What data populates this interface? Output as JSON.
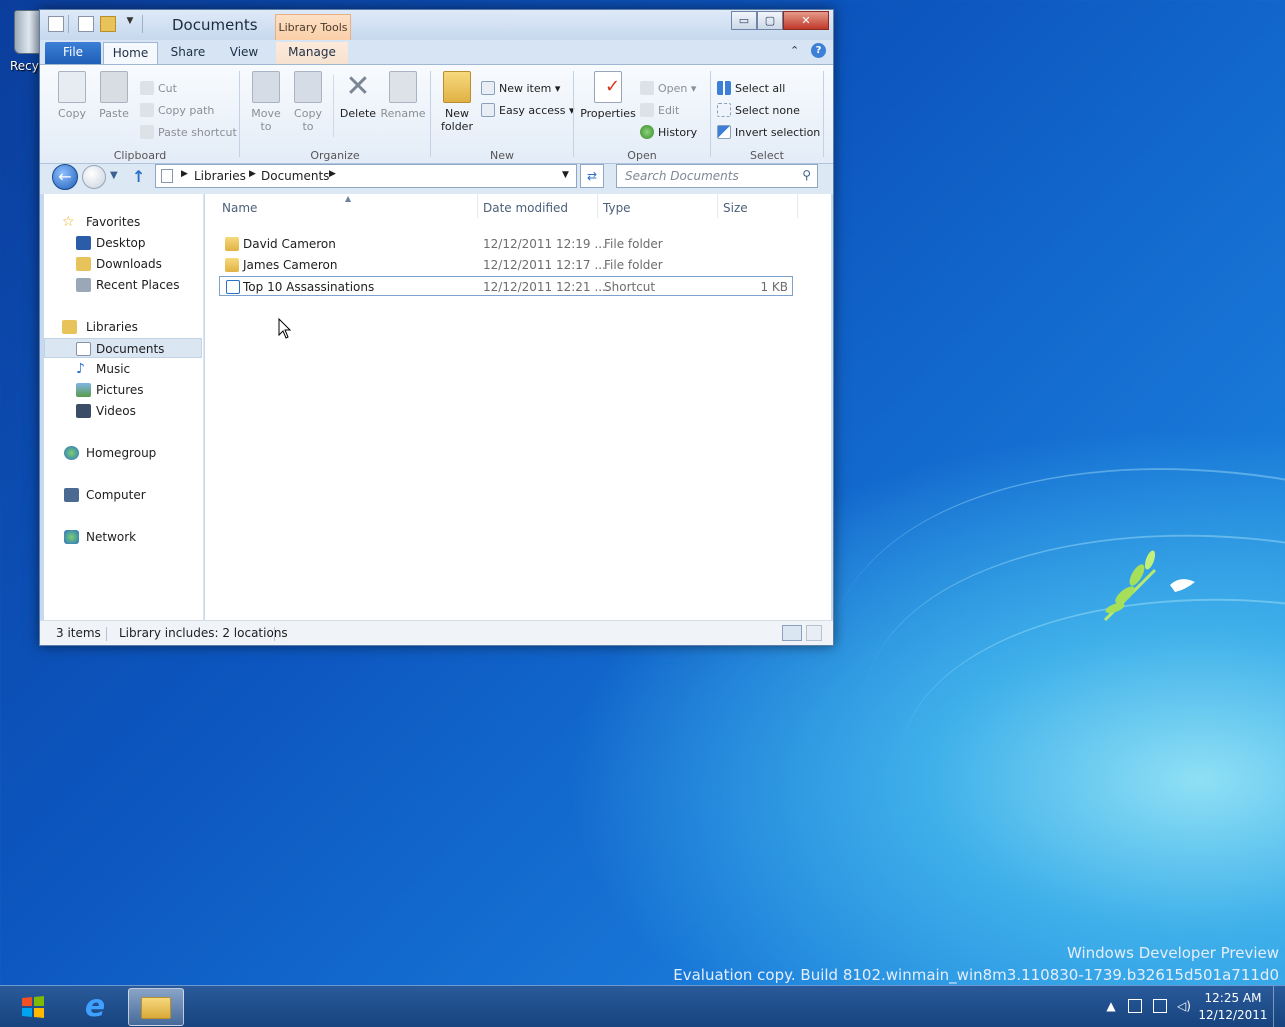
{
  "window": {
    "title": "Documents",
    "context_tab": "Library Tools"
  },
  "title_buttons": {
    "minimize": "▭",
    "maximize": "▢",
    "close": "✕"
  },
  "tabs": [
    "File",
    "Home",
    "Share",
    "View",
    "Manage"
  ],
  "ribbon": {
    "clipboard": {
      "label": "Clipboard",
      "copy": "Copy",
      "paste": "Paste",
      "cut": "Cut",
      "copy_path": "Copy path",
      "paste_shortcut": "Paste shortcut"
    },
    "organize": {
      "label": "Organize",
      "move_to": "Move to",
      "copy_to": "Copy to",
      "delete": "Delete",
      "rename": "Rename"
    },
    "new": {
      "label": "New",
      "new_folder": "New folder",
      "new_item": "New item",
      "easy_access": "Easy access"
    },
    "open": {
      "label": "Open",
      "properties": "Properties",
      "open": "Open",
      "edit": "Edit",
      "history": "History"
    },
    "select": {
      "label": "Select",
      "select_all": "Select all",
      "select_none": "Select none",
      "invert_selection": "Invert selection"
    }
  },
  "address": {
    "breadcrumb": [
      "Libraries",
      "Documents"
    ],
    "search_placeholder": "Search Documents"
  },
  "nav": {
    "favorites": "Favorites",
    "desktop": "Desktop",
    "downloads": "Downloads",
    "recent": "Recent Places",
    "libraries": "Libraries",
    "documents": "Documents",
    "music": "Music",
    "pictures": "Pictures",
    "videos": "Videos",
    "homegroup": "Homegroup",
    "computer": "Computer",
    "network": "Network"
  },
  "columns": {
    "name": "Name",
    "date": "Date modified",
    "type": "Type",
    "size": "Size"
  },
  "files": [
    {
      "name": "David Cameron",
      "date": "12/12/2011 12:19 ...",
      "type": "File folder",
      "size": ""
    },
    {
      "name": "James Cameron",
      "date": "12/12/2011 12:17 ...",
      "type": "File folder",
      "size": ""
    },
    {
      "name": "Top 10 Assassinations",
      "date": "12/12/2011 12:21 ...",
      "type": "Shortcut",
      "size": "1 KB"
    }
  ],
  "status": {
    "count": "3 items",
    "library": "Library includes: 2 locations"
  },
  "desktop": {
    "recycle_label": "Recyc",
    "watermark_line1": "Windows Developer Preview",
    "watermark_line2": "Evaluation copy. Build 8102.winmain_win8m3.110830-1739.b32615d501a711d0"
  },
  "clock": {
    "time": "12:25 AM",
    "date": "12/12/2011"
  },
  "colors": {
    "accent": "#1f5fb7",
    "folder": "#e8c35a",
    "desktop": "#0c56bf"
  }
}
